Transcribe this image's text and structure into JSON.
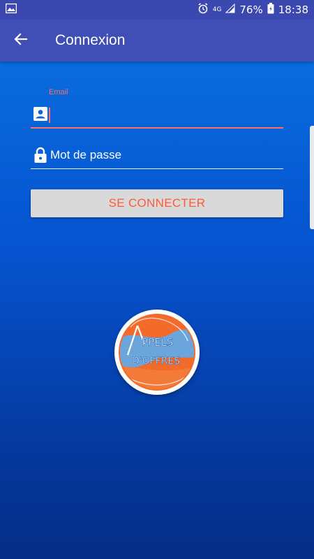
{
  "status_bar": {
    "network": "4G",
    "battery_percent": "76%",
    "time": "18:38",
    "icons": [
      "image-icon",
      "alarm-icon",
      "signal-icon",
      "battery-icon"
    ]
  },
  "app_bar": {
    "title": "Connexion",
    "back_icon": "arrow-left-icon"
  },
  "form": {
    "email": {
      "label": "Email",
      "value": "",
      "icon": "account-box-icon"
    },
    "password": {
      "placeholder": "Mot de passe",
      "value": "",
      "icon": "lock-icon"
    },
    "submit_label": "SE CONNECTER"
  },
  "logo": {
    "line1": "PPELS",
    "line2": "D'OFFRES"
  },
  "colors": {
    "accent": "#ff6f63",
    "app_bar": "#3f4fb6",
    "button_text": "#ff5a36",
    "button_bg": "#d9d9d9"
  }
}
